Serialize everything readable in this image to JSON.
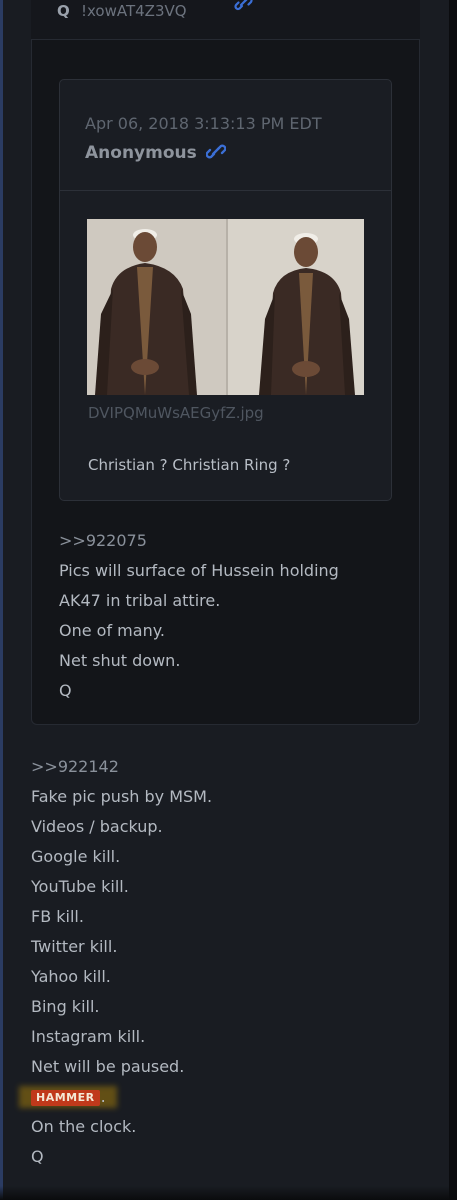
{
  "quoted_post": {
    "author_mark": "Q",
    "tripcode": "!xowAT4Z3VQ",
    "link_icon": "link-icon",
    "inner_post": {
      "date": "Apr 06, 2018 3:13:13 PM EDT",
      "author": "Anonymous",
      "link_icon": "link-icon",
      "image_filename": "DVIPQMuWsAEGyfZ.jpg",
      "caption": "Christian ? Christian Ring ?"
    },
    "lines": [
      ">>922075",
      "Pics will surface of Hussein holding",
      "AK47 in tribal attire.",
      "One of many.",
      "Net shut down.",
      "Q"
    ]
  },
  "main_post": {
    "lines_before": [
      ">>922142",
      "Fake pic push by MSM.",
      "Videos / backup.",
      "Google kill.",
      "YouTube kill.",
      "FB kill.",
      "Twitter kill.",
      "Yahoo kill.",
      "Bing kill.",
      "Instagram kill.",
      "Net will be paused."
    ],
    "hammer_badge": "HAMMER",
    "hammer_suffix": ".",
    "lines_after": [
      "On the clock.",
      "Q"
    ]
  },
  "colors": {
    "background": "#191c22",
    "badge": "#c0391b",
    "link": "#3b6fd6"
  }
}
